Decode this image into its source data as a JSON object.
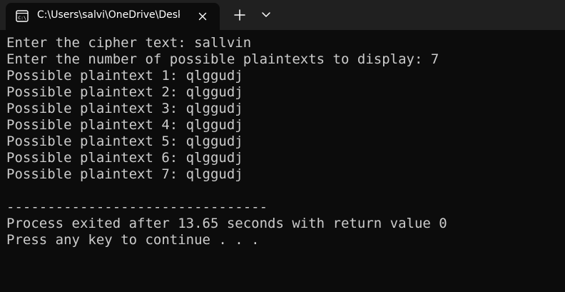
{
  "tab": {
    "title": "C:\\Users\\salvi\\OneDrive\\Desk",
    "icon": "console-icon",
    "close_icon": "close-icon"
  },
  "toolbar": {
    "new_tab_icon": "plus-icon",
    "dropdown_icon": "chevron-down-icon"
  },
  "colors": {
    "terminal_bg": "#0c0c0c",
    "titlebar_bg": "#202020",
    "text": "#cccccc"
  },
  "terminal": {
    "lines": [
      "Enter the cipher text: sallvin",
      "Enter the number of possible plaintexts to display: 7",
      "Possible plaintext 1: qlggudj",
      "Possible plaintext 2: qlggudj",
      "Possible plaintext 3: qlggudj",
      "Possible plaintext 4: qlggudj",
      "Possible plaintext 5: qlggudj",
      "Possible plaintext 6: qlggudj",
      "Possible plaintext 7: qlggudj",
      "",
      "--------------------------------",
      "Process exited after 13.65 seconds with return value 0",
      "Press any key to continue . . ."
    ]
  }
}
